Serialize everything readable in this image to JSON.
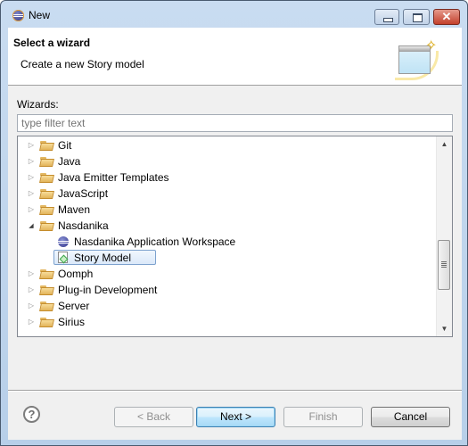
{
  "window": {
    "title": "New",
    "controls": {
      "minimize": "minimize",
      "maximize": "maximize",
      "close": "✕"
    }
  },
  "header": {
    "title": "Select a wizard",
    "description": "Create a new Story model",
    "banner_icon": "new-wizard-banner-icon"
  },
  "wizards": {
    "label": "Wizards:",
    "filter": {
      "value": "",
      "placeholder": "type filter text"
    },
    "tree": [
      {
        "label": "Git",
        "type": "folder",
        "expanded": false,
        "level": 0
      },
      {
        "label": "Java",
        "type": "folder",
        "expanded": false,
        "level": 0
      },
      {
        "label": "Java Emitter Templates",
        "type": "folder",
        "expanded": false,
        "level": 0
      },
      {
        "label": "JavaScript",
        "type": "folder",
        "expanded": false,
        "level": 0
      },
      {
        "label": "Maven",
        "type": "folder",
        "expanded": false,
        "level": 0
      },
      {
        "label": "Nasdanika",
        "type": "folder",
        "expanded": true,
        "level": 0
      },
      {
        "label": "Nasdanika Application Workspace",
        "type": "eclipse-wizard",
        "level": 1
      },
      {
        "label": "Story Model",
        "type": "story-model",
        "level": 1,
        "selected": true
      },
      {
        "label": "Oomph",
        "type": "folder",
        "expanded": false,
        "level": 0
      },
      {
        "label": "Plug-in Development",
        "type": "folder",
        "expanded": false,
        "level": 0
      },
      {
        "label": "Server",
        "type": "folder",
        "expanded": false,
        "level": 0
      },
      {
        "label": "Sirius",
        "type": "folder",
        "expanded": false,
        "level": 0
      }
    ],
    "scroll_position": 0.72
  },
  "footer": {
    "help_icon": "?",
    "back": "< Back",
    "next": "Next >",
    "finish": "Finish",
    "cancel": "Cancel"
  }
}
